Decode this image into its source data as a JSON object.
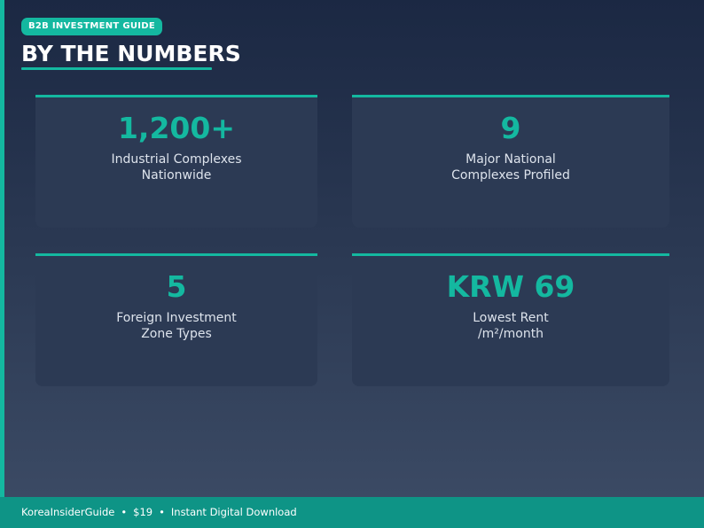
{
  "header": {
    "badge": "B2B INVESTMENT GUIDE",
    "title": "BY THE NUMBERS"
  },
  "stats": [
    {
      "value": "1,200+",
      "label_line1": "Industrial Complexes",
      "label_line2": "Nationwide"
    },
    {
      "value": "9",
      "label_line1": "Major National",
      "label_line2": "Complexes Profiled"
    },
    {
      "value": "5",
      "label_line1": "Foreign Investment",
      "label_line2": "Zone Types"
    },
    {
      "value": "KRW 69",
      "label_line1": "Lowest Rent",
      "label_line2": "/m²/month"
    }
  ],
  "footer": {
    "brand": "KoreaInsiderGuide",
    "price": "$19",
    "delivery": "Instant Digital Download",
    "separator": "•"
  },
  "colors": {
    "accent": "#14b8a0",
    "footer_bg": "#0e9486",
    "background_top": "#1b2843",
    "background_bottom": "#3d4c66",
    "card_bg": "#2c3a54"
  }
}
